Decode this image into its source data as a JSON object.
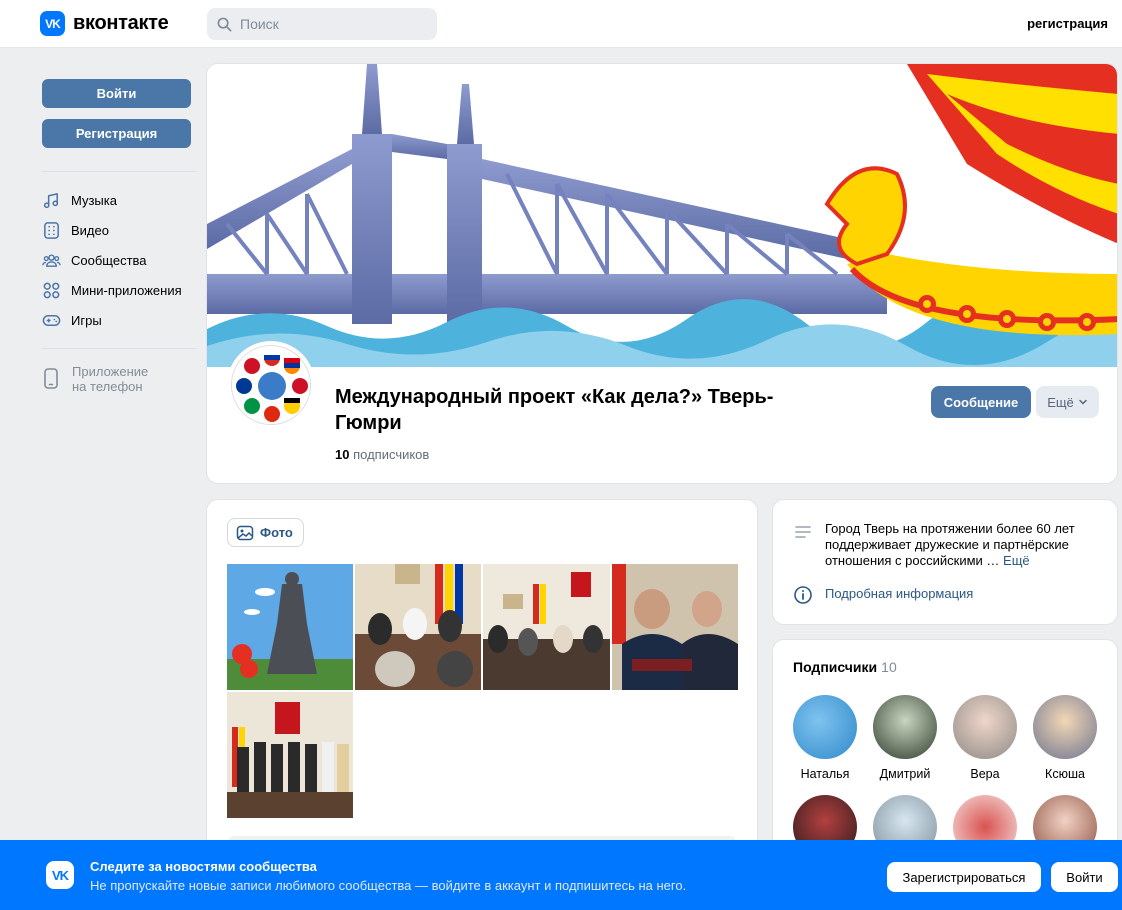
{
  "header": {
    "logo_text": "вконтакте",
    "logo_mark": "VK",
    "search_placeholder": "Поиск",
    "register_link": "регистрация"
  },
  "sidebar": {
    "login_button": "Войти",
    "register_button": "Регистрация",
    "items": [
      {
        "label": "Музыка",
        "icon": "music-icon"
      },
      {
        "label": "Видео",
        "icon": "video-icon"
      },
      {
        "label": "Сообщества",
        "icon": "communities-icon"
      },
      {
        "label": "Мини-приложения",
        "icon": "mini-apps-icon"
      },
      {
        "label": "Игры",
        "icon": "games-icon"
      }
    ],
    "app_line1": "Приложение",
    "app_line2": "на телефон"
  },
  "group": {
    "title": "Международный проект «Как дела?» Тверь-Гюмри",
    "subscribers_count": "10",
    "subscribers_label": "подписчиков",
    "message_button": "Сообщение",
    "more_button": "Ещё"
  },
  "photos": {
    "tab_label": "Фото"
  },
  "info": {
    "description": "Город Тверь на протяжении более 60 лет поддерживает дружеские и партнёрские отношения с российскими …",
    "more_link": "Ещё",
    "details_link": "Подробная информация"
  },
  "members": {
    "title": "Подписчики",
    "count": "10",
    "list": [
      {
        "name": "Наталья"
      },
      {
        "name": "Дмитрий"
      },
      {
        "name": "Вера"
      },
      {
        "name": "Ксюша"
      }
    ]
  },
  "banner": {
    "title": "Следите за новостями сообщества",
    "subtitle": "Не пропускайте новые записи любимого сообщества — войдите в аккаунт и подпишитесь на него.",
    "register_button": "Зарегистрироваться",
    "login_button": "Войти"
  },
  "colors": {
    "accent": "#4a76a8",
    "vk_blue": "#0077ff",
    "link": "#2a5885",
    "background": "#edeef0"
  }
}
